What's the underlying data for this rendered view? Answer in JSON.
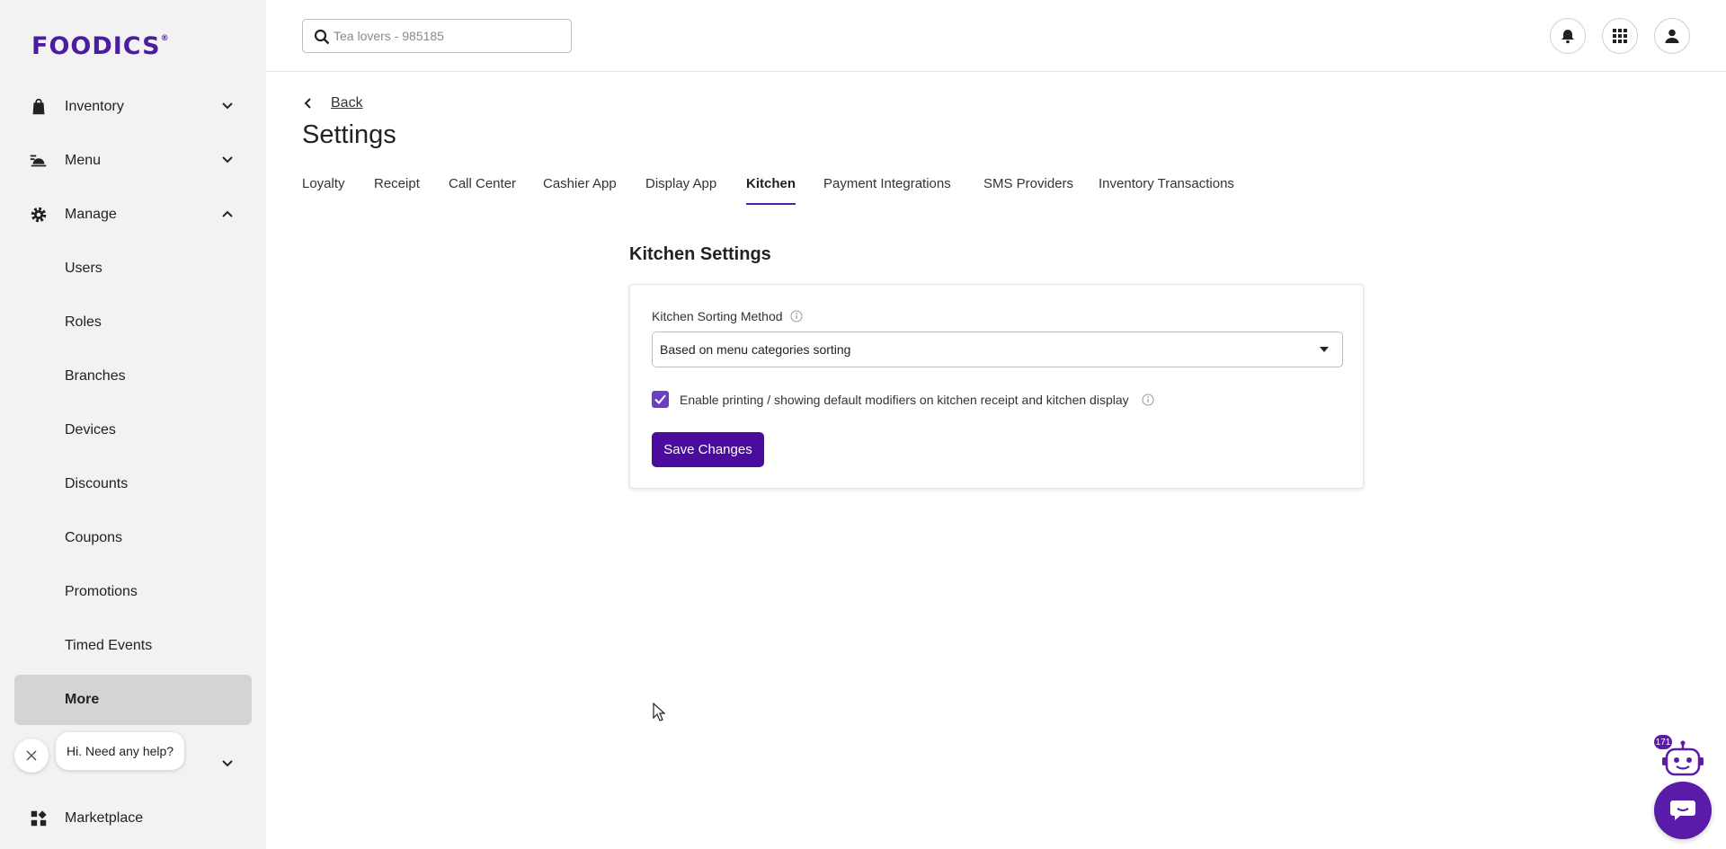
{
  "sidebar": {
    "logo": "FOODICS",
    "logo_mark": "®",
    "items": [
      {
        "label": "Inventory",
        "icon": "shopping-bag-icon",
        "expanded": false
      },
      {
        "label": "Menu",
        "icon": "food-tray-icon",
        "expanded": false
      },
      {
        "label": "Manage",
        "icon": "gear-icon",
        "expanded": true
      }
    ],
    "sub_items": [
      "Users",
      "Roles",
      "Branches",
      "Devices",
      "Discounts",
      "Coupons",
      "Promotions",
      "Timed Events",
      "More"
    ],
    "active_sub_item": "More",
    "marketplace": {
      "label": "Marketplace",
      "icon": "apps-grid-icon"
    }
  },
  "header": {
    "search_placeholder": "Tea lovers - 985185",
    "icons": [
      "bell-icon",
      "apps-grid-icon",
      "user-icon"
    ]
  },
  "main": {
    "back_label": "Back",
    "title": "Settings",
    "tabs": [
      "Loyalty",
      "Receipt",
      "Call Center",
      "Cashier App",
      "Display App",
      "Kitchen",
      "Payment Integrations",
      "SMS Providers",
      "Inventory Transactions"
    ],
    "active_tab": "Kitchen",
    "section_title": "Kitchen Settings",
    "sorting_label": "Kitchen Sorting Method",
    "sorting_value": "Based on menu categories sorting",
    "checkbox_label": "Enable printing / showing default modifiers on kitchen receipt and kitchen display",
    "checkbox_checked": true,
    "save_label": "Save Changes"
  },
  "help": {
    "bubble_text": "Hi. Need any help?",
    "badge_count": "171"
  },
  "colors": {
    "brand": "#4b1ca0",
    "primary_button": "#4b0c9e",
    "checkbox": "#6b3fc1",
    "sidebar_bg": "#f2f2f2",
    "active_item_bg": "#d4d4d4"
  }
}
